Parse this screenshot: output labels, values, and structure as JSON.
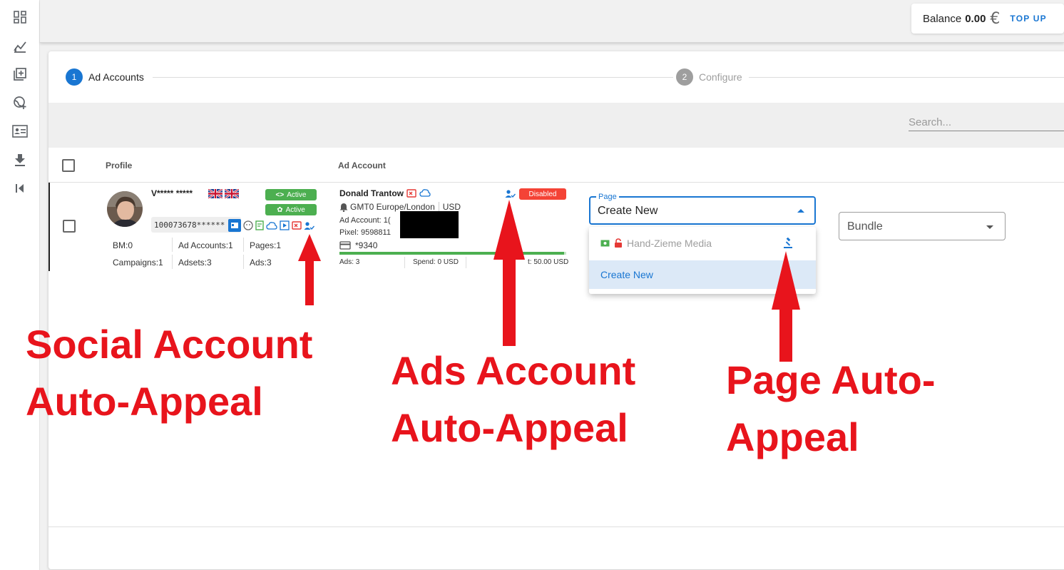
{
  "sidebar": {
    "icons": [
      "dashboard-icon",
      "chart-icon",
      "add-library-icon",
      "globe-add-icon",
      "id-card-icon",
      "download-icon",
      "first-page-icon"
    ]
  },
  "topbar": {
    "balance_label": "Balance",
    "balance_amount": "0.00",
    "currency_symbol": "€",
    "topup_label": "TOP UP"
  },
  "stepper": {
    "steps": [
      {
        "num": "1",
        "label": "Ad Accounts",
        "active": true
      },
      {
        "num": "2",
        "label": "Configure",
        "active": false
      }
    ]
  },
  "search": {
    "placeholder": "Search..."
  },
  "table": {
    "headers": {
      "profile": "Profile",
      "ad_account": "Ad Account"
    },
    "row": {
      "profile": {
        "name": "V***** *****",
        "status_badges": [
          "Active",
          "Active"
        ],
        "uid": "100073678******",
        "stats": {
          "bm": "BM:0",
          "ad_accounts": "Ad Accounts:1",
          "pages": "Pages:1",
          "campaigns": "Campaigns:1",
          "adsets": "Adsets:3",
          "ads": "Ads:3"
        }
      },
      "ad_account": {
        "name": "Donald Trantow",
        "status": "Disabled",
        "timezone": "GMT0 Europe/London",
        "currency": "USD",
        "id_label": "Ad Account: 1(",
        "pixel_label": "Pixel: 9598811",
        "card": "*9340",
        "ads": "Ads: 3",
        "spend": "Spend: 0 USD",
        "limit": "t: 50.00 USD",
        "progress": 0.99
      }
    }
  },
  "page_select": {
    "label": "Page",
    "value": "Create New",
    "options": [
      {
        "label": "Hand-Zieme Media",
        "disabled": true
      },
      {
        "label": "Create New",
        "selected": true
      }
    ]
  },
  "bundle_select": {
    "value": "Bundle"
  },
  "annotations": {
    "social_line1": "Social Account",
    "social_line2": "Auto-Appeal",
    "ads_line1": "Ads Account",
    "ads_line2": "Auto-Appeal",
    "page_line1": "Page Auto-",
    "page_line2": "Appeal"
  },
  "colors": {
    "primary": "#1976d2",
    "active_green": "#4caf50",
    "disabled_red": "#f44336",
    "annotation_red": "#e8141c"
  }
}
